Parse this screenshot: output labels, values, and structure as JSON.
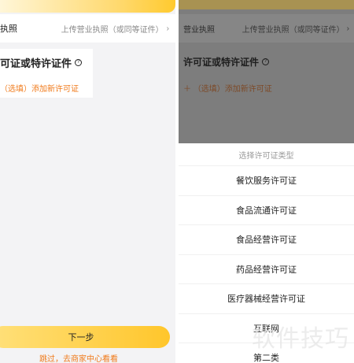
{
  "left": {
    "license_label": "执照",
    "license_value": "上传营业执照（或同等证件）",
    "license_arrow": "›",
    "permit_title": "可证或特许证件",
    "permit_help_icon": "?",
    "permit_add": "（选填）添加新许可证",
    "next_button": "下一步",
    "skip_link": "跳过，去商家中心看看"
  },
  "right": {
    "license_label": "营业执照",
    "license_value": "上传营业执照（或同等证件）",
    "license_arrow": "›",
    "permit_title": "许可证或特许证件",
    "permit_help_icon": "?",
    "permit_add": "＋  （选填）添加新许可证",
    "sheet_title": "选择许可证类型",
    "options": [
      "餐饮服务许可证",
      "食品流通许可证",
      "食品经营许可证",
      "药品经营许可证",
      "医疗器械经营许可证",
      "互联网",
      "第二类"
    ]
  },
  "watermark": "软件技巧",
  "colors": {
    "accent_orange": "#f07b1c",
    "button_yellow": "#ffc62b",
    "overlay_gray": "#7d7d7d"
  }
}
